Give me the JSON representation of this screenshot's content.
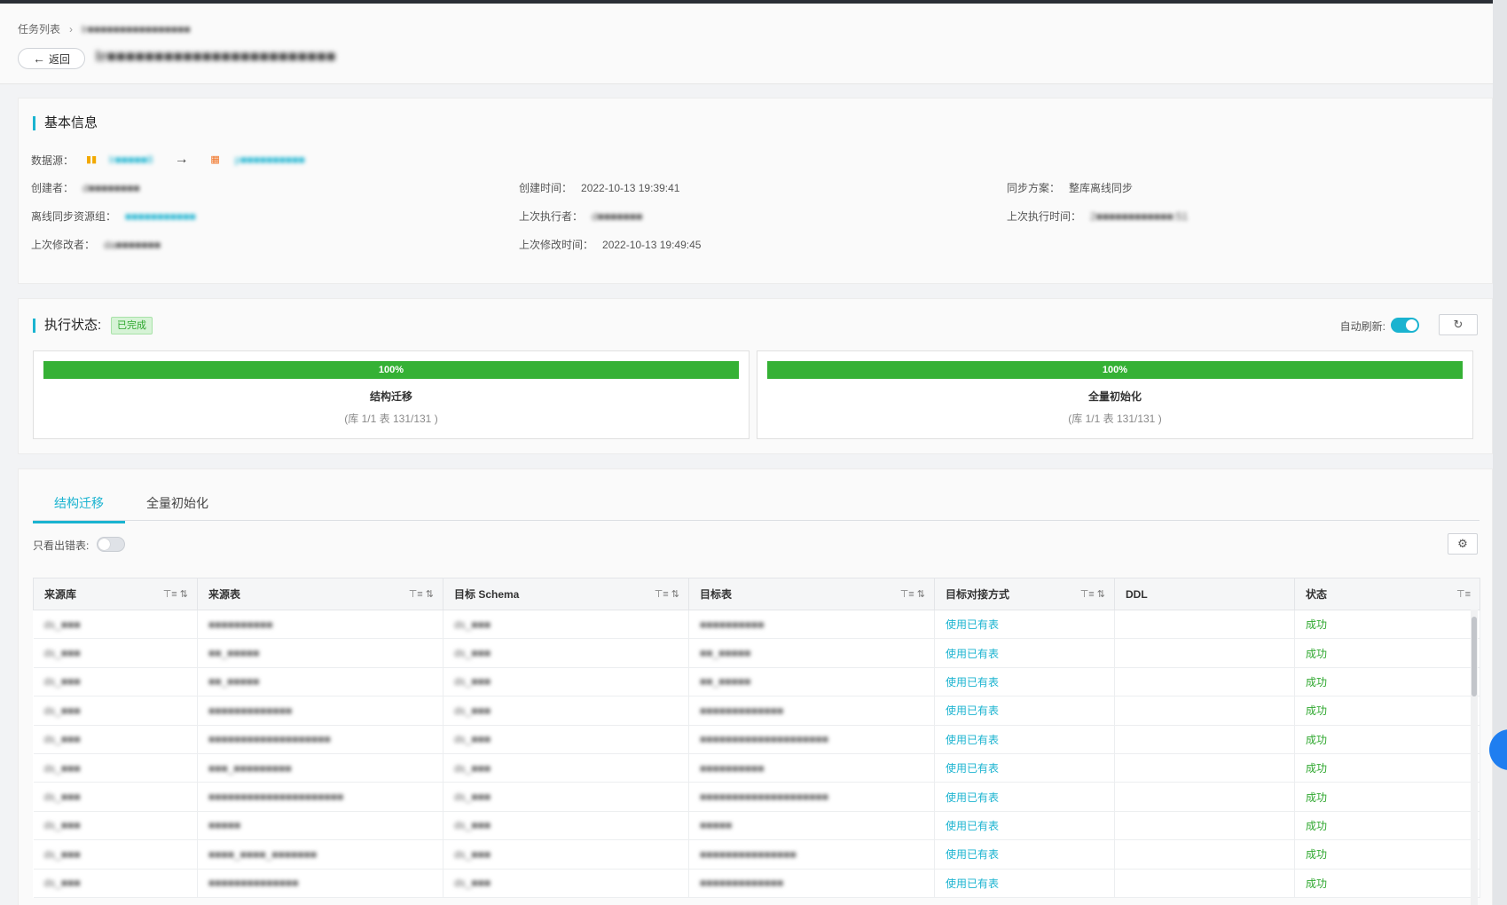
{
  "breadcrumb": {
    "root": "任务列表",
    "current": "lr■■■■■■■■■■■■■■■■"
  },
  "header": {
    "back_label": "返回",
    "task_name": "lr■■■■■■■■■■■■■■■■■■■■■■■■"
  },
  "basic_info": {
    "title": "基本信息",
    "datasource_label": "数据源：",
    "source_db": "lr■■■■■8",
    "target_db": "p■■■■■■■■■■",
    "creator_label": "创建者：",
    "creator": "d■■■■■■■■",
    "create_time_label": "创建时间：",
    "create_time": "2022-10-13 19:39:41",
    "sync_plan_label": "同步方案：",
    "sync_plan": "整库离线同步",
    "resource_group_label": "离线同步资源组：",
    "resource_group": "■■■■■■■■■■■",
    "last_executor_label": "上次执行者：",
    "last_executor": "d■■■■■■■",
    "last_exec_time_label": "上次执行时间：",
    "last_exec_time": "2■■■■■■■■■■■■:51",
    "last_modifier_label": "上次修改者：",
    "last_modifier": "da■■■■■■■",
    "last_modified_time_label": "上次修改时间：",
    "last_modified_time": "2022-10-13 19:49:45"
  },
  "execution": {
    "title": "执行状态:",
    "status": "已完成",
    "auto_refresh_label": "自动刷新:",
    "auto_refresh": true,
    "progress": [
      {
        "name": "结构迁移",
        "percent": 100,
        "percent_label": "100%",
        "detail": "(库 1/1 表 131/131 )"
      },
      {
        "name": "全量初始化",
        "percent": 100,
        "percent_label": "100%",
        "detail": "(库 1/1 表 131/131 )"
      }
    ]
  },
  "tabs": [
    {
      "label": "结构迁移",
      "active": true
    },
    {
      "label": "全量初始化",
      "active": false
    }
  ],
  "filter": {
    "errors_only_label": "只看出错表:",
    "errors_only": false
  },
  "table": {
    "columns": [
      "来源库",
      "来源表",
      "目标 Schema",
      "目标表",
      "目标对接方式",
      "DDL",
      "状态"
    ],
    "rows": [
      [
        "ds_■■■",
        "■■■■■■■■■■",
        "ds_■■■",
        "■■■■■■■■■■",
        "使用已有表",
        "",
        "成功"
      ],
      [
        "ds_■■■",
        "■■_■■■■■",
        "ds_■■■",
        "■■_■■■■■",
        "使用已有表",
        "",
        "成功"
      ],
      [
        "ds_■■■",
        "■■_■■■■■",
        "ds_■■■",
        "■■_■■■■■",
        "使用已有表",
        "",
        "成功"
      ],
      [
        "ds_■■■",
        "■■■■■■■■■■■■■",
        "ds_■■■",
        "■■■■■■■■■■■■■",
        "使用已有表",
        "",
        "成功"
      ],
      [
        "ds_■■■",
        "■■■■■■■■■■■■■■■■■■■",
        "ds_■■■",
        "■■■■■■■■■■■■■■■■■■■■",
        "使用已有表",
        "",
        "成功"
      ],
      [
        "ds_■■■",
        "■■■_■■■■■■■■■",
        "ds_■■■",
        "■■■■■■■■■■",
        "使用已有表",
        "",
        "成功"
      ],
      [
        "ds_■■■",
        "■■■■■■■■■■■■■■■■■■■■■",
        "ds_■■■",
        "■■■■■■■■■■■■■■■■■■■■",
        "使用已有表",
        "",
        "成功"
      ],
      [
        "ds_■■■",
        "■■■■■",
        "ds_■■■",
        "■■■■■",
        "使用已有表",
        "",
        "成功"
      ],
      [
        "ds_■■■",
        "■■■■_■■■■_■■■■■■■",
        "ds_■■■",
        "■■■■■■■■■■■■■■■",
        "使用已有表",
        "",
        "成功"
      ],
      [
        "ds_■■■",
        "■■■■■■■■■■■■■■",
        "ds_■■■",
        "■■■■■■■■■■■■■",
        "使用已有表",
        "",
        "成功"
      ]
    ]
  },
  "colors": {
    "accent": "#1ab3d0",
    "success": "#2ea72e",
    "progress": "#35b135"
  }
}
